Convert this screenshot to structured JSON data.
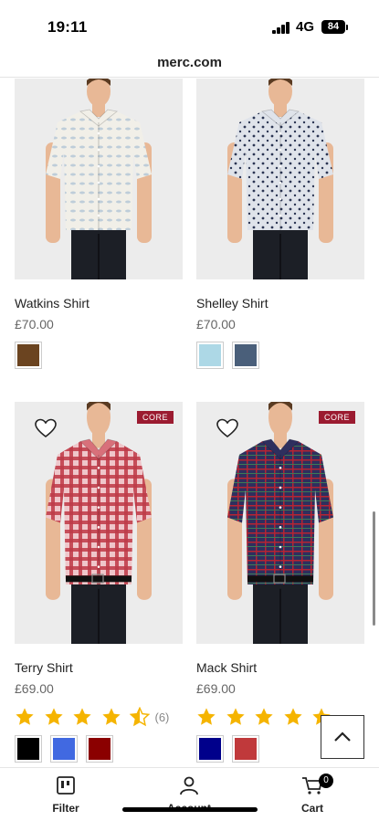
{
  "status_bar": {
    "time": "19:11",
    "network": "4G",
    "battery": "84"
  },
  "browser": {
    "url": "merc.com"
  },
  "products": [
    {
      "name": "Watkins Shirt",
      "price": "£70.00",
      "badge": "",
      "swatches": [
        "#6b4420"
      ],
      "shirt_color": "#f1efe8",
      "pattern": "leaf"
    },
    {
      "name": "Shelley Shirt",
      "price": "£70.00",
      "badge": "",
      "swatches": [
        "#add8e6",
        "#4a5f7a"
      ],
      "shirt_color": "#dfe3ea",
      "pattern": "dots"
    },
    {
      "name": "Terry Shirt",
      "price": "£69.00",
      "badge": "CORE",
      "rating": 4.5,
      "reviews": "(6)",
      "swatches": [
        "#000000",
        "#4169e1",
        "#8b0000"
      ],
      "shirt_color": "#d8707a",
      "pattern": "gingham"
    },
    {
      "name": "Mack Shirt",
      "price": "£69.00",
      "badge": "CORE",
      "rating": 5,
      "reviews": "",
      "swatches": [
        "#00008b",
        "#c0393b"
      ],
      "shirt_color": "#2e2f5e",
      "pattern": "plaid"
    }
  ],
  "bottom_nav": {
    "filter_label": "Filter",
    "account_label": "Account",
    "cart_label": "Cart",
    "cart_count": "0"
  },
  "colors": {
    "star": "#f5b400",
    "core_badge": "#9b1b30"
  }
}
